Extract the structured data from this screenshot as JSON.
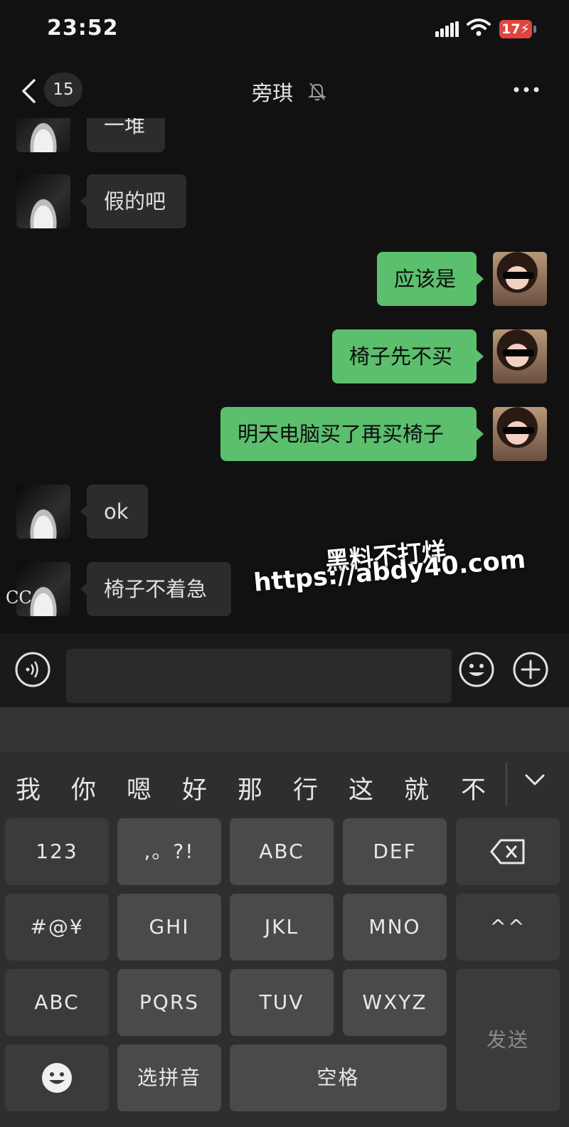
{
  "status_bar": {
    "time": "23:52",
    "battery": "17"
  },
  "header": {
    "unread_count": "15",
    "title": "旁琪"
  },
  "messages": [
    {
      "from": "other",
      "text": "一堆"
    },
    {
      "from": "other",
      "text": "假的吧"
    },
    {
      "from": "me",
      "text": "应该是"
    },
    {
      "from": "me",
      "text": "椅子先不买"
    },
    {
      "from": "me",
      "text": "明天电脑买了再买椅子"
    },
    {
      "from": "other",
      "text": "ok"
    },
    {
      "from": "other",
      "text": "椅子不着急"
    }
  ],
  "watermark": {
    "line1": "黑料不打烊",
    "line2": "https://abdy40.com"
  },
  "corner_text": "CC",
  "input": {
    "value": ""
  },
  "keyboard": {
    "candidates": [
      "我",
      "你",
      "嗯",
      "好",
      "那",
      "行",
      "这",
      "就",
      "不"
    ],
    "rows": [
      [
        "123",
        ",。?!",
        "ABC",
        "DEF"
      ],
      [
        "#@¥",
        "GHI",
        "JKL",
        "MNO",
        "^^"
      ],
      [
        "ABC",
        "PQRS",
        "TUV",
        "WXYZ"
      ],
      [
        "选拼音",
        "空格"
      ]
    ],
    "send_label": "发送"
  },
  "icons": [
    "back-icon",
    "mute-bell-icon",
    "more-icon",
    "voice-icon",
    "emoji-icon",
    "add-icon",
    "chevron-down-icon",
    "backspace-icon",
    "emoji-key-icon",
    "signal-icon",
    "wifi-icon",
    "battery-icon"
  ]
}
